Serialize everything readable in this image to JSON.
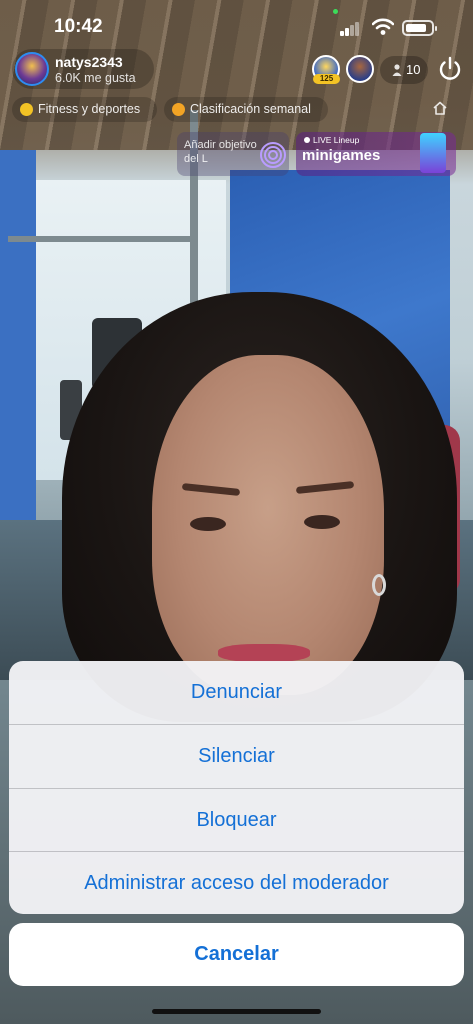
{
  "status_bar": {
    "time": "10:42"
  },
  "host": {
    "name": "natys2343",
    "likes": "6.0K me gusta"
  },
  "viewers": {
    "count": "10",
    "top_badge": "125"
  },
  "chips": [
    {
      "label": "Fitness y deportes"
    },
    {
      "label": "Clasificación semanal"
    }
  ],
  "widgets": {
    "goal_text": "Añadir objetivo del L",
    "lineup_label": "LIVE Lineup",
    "lineup_title": "minigames"
  },
  "action_sheet": {
    "items": [
      {
        "label": "Denunciar"
      },
      {
        "label": "Silenciar"
      },
      {
        "label": "Bloquear"
      },
      {
        "label": "Administrar acceso del moderador"
      }
    ],
    "cancel_label": "Cancelar"
  },
  "colors": {
    "action_blue": "#1470d6",
    "sheet_bg": "#f2f2f6",
    "chip_gold": "#f3c325"
  }
}
